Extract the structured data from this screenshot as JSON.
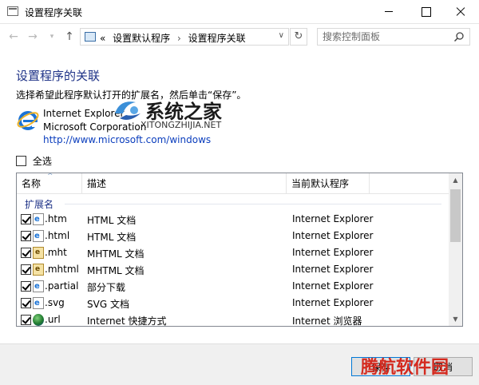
{
  "window": {
    "title": "设置程序关联"
  },
  "nav": {
    "breadcrumb_overflow": "«",
    "crumbs": [
      "设置默认程序",
      "设置程序关联"
    ],
    "search_placeholder": "搜索控制面板"
  },
  "main": {
    "heading": "设置程序的关联",
    "instruction": "选择希望此程序默认打开的扩展名，然后单击“保存”。",
    "program": {
      "name": "Internet Explorer",
      "company": "Microsoft Corporation",
      "url": "http://www.microsoft.com/windows"
    },
    "select_all": {
      "label": "全选",
      "checked": false
    }
  },
  "list": {
    "columns": [
      "名称",
      "描述",
      "当前默认程序"
    ],
    "group": "扩展名",
    "rows": [
      {
        "ext": ".htm",
        "desc": "HTML 文档",
        "program": "Internet Explorer",
        "checked": true,
        "icon": "ie-document-icon"
      },
      {
        "ext": ".html",
        "desc": "HTML 文档",
        "program": "Internet Explorer",
        "checked": true,
        "icon": "ie-document-icon"
      },
      {
        "ext": ".mht",
        "desc": "MHTML 文档",
        "program": "Internet Explorer",
        "checked": true,
        "icon": "mhtml-icon"
      },
      {
        "ext": ".mhtml",
        "desc": "MHTML 文档",
        "program": "Internet Explorer",
        "checked": true,
        "icon": "mhtml-icon"
      },
      {
        "ext": ".partial",
        "desc": "部分下载",
        "program": "Internet Explorer",
        "checked": true,
        "icon": "ie-document-icon"
      },
      {
        "ext": ".svg",
        "desc": "SVG 文档",
        "program": "Internet Explorer",
        "checked": true,
        "icon": "ie-document-icon"
      },
      {
        "ext": ".url",
        "desc": "Internet 快捷方式",
        "program": "Internet 浏览器",
        "checked": true,
        "icon": "globe-icon"
      }
    ]
  },
  "footer": {
    "save_label": "保存",
    "cancel_label": "取消"
  },
  "watermarks": {
    "top_text": "系统之家",
    "top_sub": "XITONGZHIJIA.NET",
    "bottom_text": "腾航软件园"
  },
  "colors": {
    "heading": "#1e3287",
    "link": "#0a3dbd",
    "accent": "#0078d7",
    "watermark_red": "#d42a1f"
  }
}
